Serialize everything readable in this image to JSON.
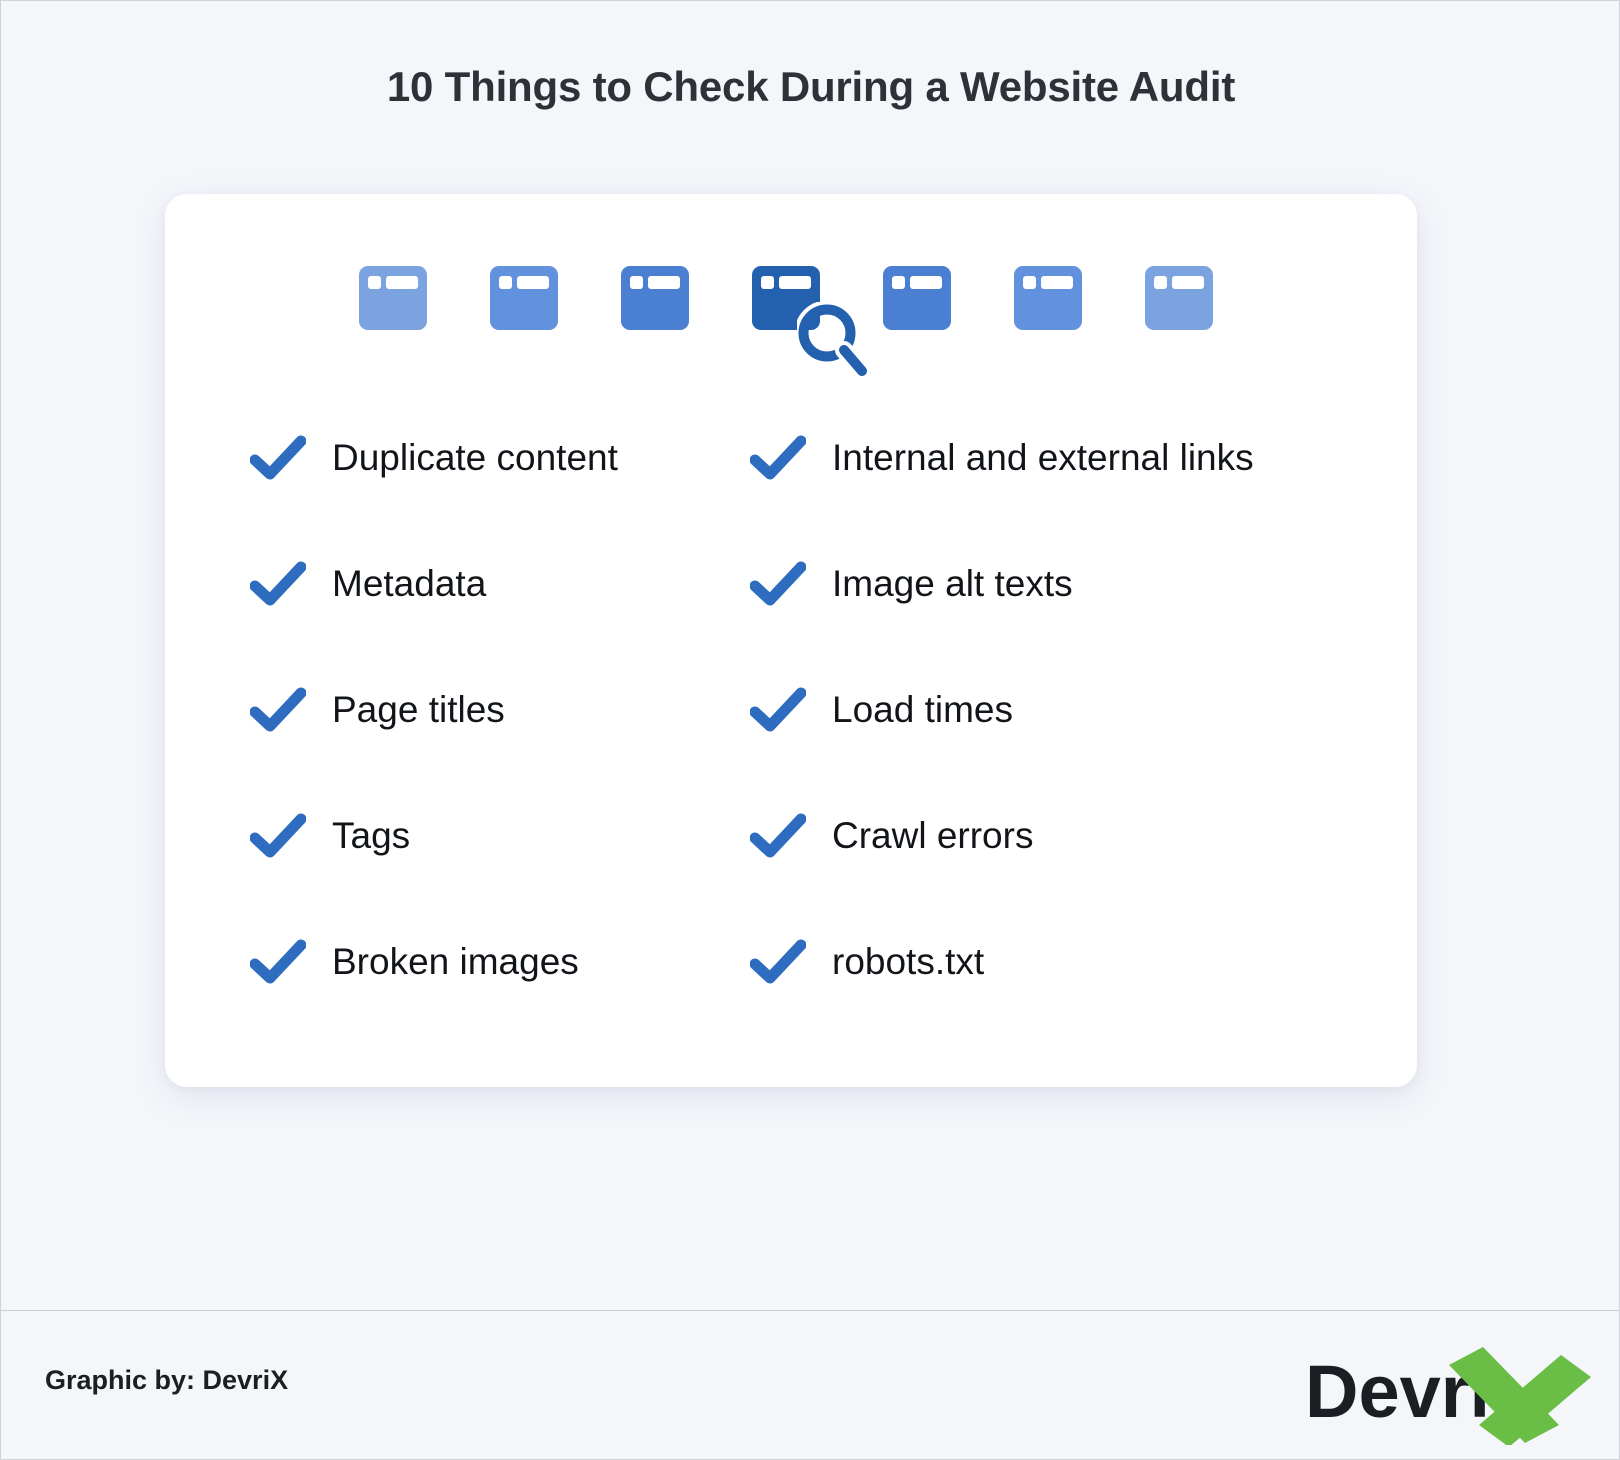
{
  "page": {
    "title": "10 Things to Check During a Website Audit",
    "background_color": "#f4f6fa",
    "card_color": "#ffffff"
  },
  "icon_strip": {
    "icon_name": "browser-window-icon",
    "search_icon_name": "magnifying-glass-icon",
    "count": 7,
    "highlight_index": 4,
    "colors": [
      "#7ba3e0",
      "#6291dd",
      "#4a7fd1",
      "#2360ae",
      "#4a7fd1",
      "#6291dd",
      "#7ba3e0"
    ],
    "highlight_color": "#2360ae"
  },
  "checklist": {
    "check_color": "#2e6cc0",
    "columns": [
      {
        "name": "left-column",
        "items": [
          "Duplicate content",
          "Metadata",
          "Page titles",
          "Tags",
          "Broken images"
        ]
      },
      {
        "name": "right-column",
        "items": [
          "Internal and external links",
          "Image alt texts",
          "Load times",
          "Crawl errors",
          "robots.txt"
        ]
      }
    ]
  },
  "footer": {
    "credit": "Graphic by: DevriX",
    "logo": {
      "text": "Devri",
      "mark": "X",
      "text_color": "#1b1e22",
      "mark_color": "#6abd45"
    }
  }
}
